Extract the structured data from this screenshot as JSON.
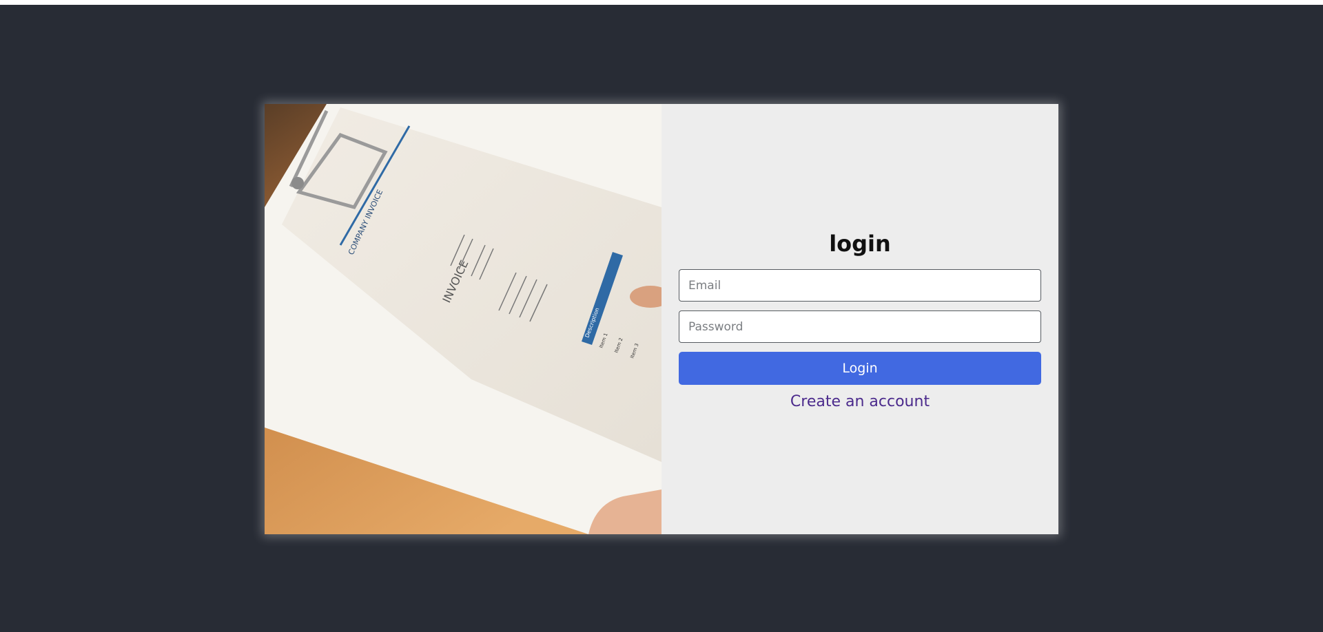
{
  "login_form": {
    "title": "login",
    "email_placeholder": "Email",
    "password_placeholder": "Password",
    "submit_label": "Login",
    "create_account_label": "Create an account"
  },
  "hero_image": {
    "description_icon": "clipboard-invoice-photo",
    "document_heading": "COMPANY INVOICE",
    "document_word": "INVOICE",
    "table_header": "Description",
    "rows": [
      "Item 1",
      "Item 2",
      "Item 3"
    ]
  },
  "colors": {
    "page_background": "#282c35",
    "panel_background": "#ededed",
    "button_background": "#4169e1",
    "link_color": "#4b2a8c"
  }
}
